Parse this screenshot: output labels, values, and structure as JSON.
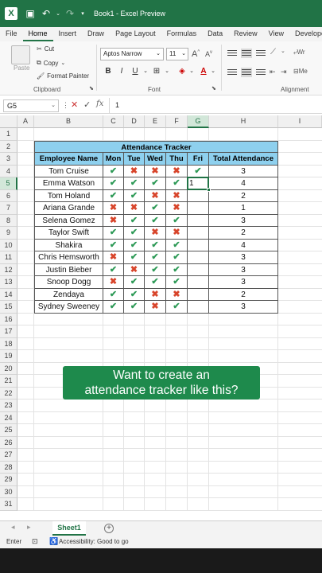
{
  "window": {
    "title": "Book1  -  Excel Preview"
  },
  "ribbon": {
    "tabs": [
      "File",
      "Home",
      "Insert",
      "Draw",
      "Page Layout",
      "Formulas",
      "Data",
      "Review",
      "View",
      "Developer"
    ],
    "active_tab": "Home",
    "clipboard": {
      "paste": "Paste",
      "cut": "Cut",
      "copy": "Copy",
      "format_painter": "Format Painter",
      "label": "Clipboard"
    },
    "font": {
      "name": "Aptos Narrow",
      "size": "11",
      "label": "Font",
      "bold": "B",
      "italic": "I",
      "underline": "U"
    },
    "alignment": {
      "label": "Alignment",
      "wrap": "Wr",
      "merge": "Me"
    }
  },
  "formula_bar": {
    "name_box": "G5",
    "fx": "fx",
    "value": "1"
  },
  "columns": [
    "A",
    "B",
    "C",
    "D",
    "E",
    "F",
    "G",
    "H",
    "I"
  ],
  "selected_column": "G",
  "rows": [
    "1",
    "2",
    "3",
    "4",
    "5",
    "6",
    "7",
    "8",
    "9",
    "10",
    "11",
    "12",
    "13",
    "14",
    "15",
    "16",
    "17",
    "18",
    "19",
    "20",
    "21",
    "22",
    "23",
    "24",
    "25",
    "26",
    "27",
    "28",
    "29",
    "30",
    "31"
  ],
  "selected_row": "5",
  "tracker": {
    "title": "Attendance Tracker",
    "headers": [
      "Employee Name",
      "Mon",
      "Tue",
      "Wed",
      "Thu",
      "Fri",
      "Total Attendance"
    ],
    "employees": [
      {
        "name": "Tom Cruise",
        "days": [
          "y",
          "n",
          "n",
          "n",
          "y"
        ],
        "total": "3"
      },
      {
        "name": "Emma Watson",
        "days": [
          "y",
          "y",
          "y",
          "y",
          "1"
        ],
        "total": "4"
      },
      {
        "name": "Tom Holand",
        "days": [
          "y",
          "y",
          "n",
          "n",
          ""
        ],
        "total": "2"
      },
      {
        "name": "Ariana Grande",
        "days": [
          "n",
          "n",
          "y",
          "n",
          ""
        ],
        "total": "1"
      },
      {
        "name": "Selena Gomez",
        "days": [
          "n",
          "y",
          "y",
          "y",
          ""
        ],
        "total": "3"
      },
      {
        "name": "Taylor Swift",
        "days": [
          "y",
          "y",
          "n",
          "n",
          ""
        ],
        "total": "2"
      },
      {
        "name": "Shakira",
        "days": [
          "y",
          "y",
          "y",
          "y",
          ""
        ],
        "total": "4"
      },
      {
        "name": "Chris Hemsworth",
        "days": [
          "n",
          "y",
          "y",
          "y",
          ""
        ],
        "total": "3"
      },
      {
        "name": "Justin Bieber",
        "days": [
          "y",
          "n",
          "y",
          "y",
          ""
        ],
        "total": "3"
      },
      {
        "name": "Snoop Dogg",
        "days": [
          "n",
          "y",
          "y",
          "y",
          ""
        ],
        "total": "3"
      },
      {
        "name": "Zendaya",
        "days": [
          "y",
          "y",
          "n",
          "n",
          ""
        ],
        "total": "2"
      },
      {
        "name": "Sydney Sweeney",
        "days": [
          "y",
          "y",
          "n",
          "y",
          ""
        ],
        "total": "3"
      }
    ],
    "check_symbol": "✔",
    "cross_symbol": "✖"
  },
  "banner": {
    "line1": "Want to create an",
    "line2": "attendance tracker like this?"
  },
  "sheets": {
    "active": "Sheet1",
    "add": "+"
  },
  "status": {
    "mode": "Enter",
    "accessibility": "Accessibility: Good to go"
  },
  "colors": {
    "excel_green": "#217346",
    "header_fill": "#8ed0ee",
    "check": "#2e9a57",
    "cross": "#d8452b",
    "banner": "#1e8a4c"
  }
}
